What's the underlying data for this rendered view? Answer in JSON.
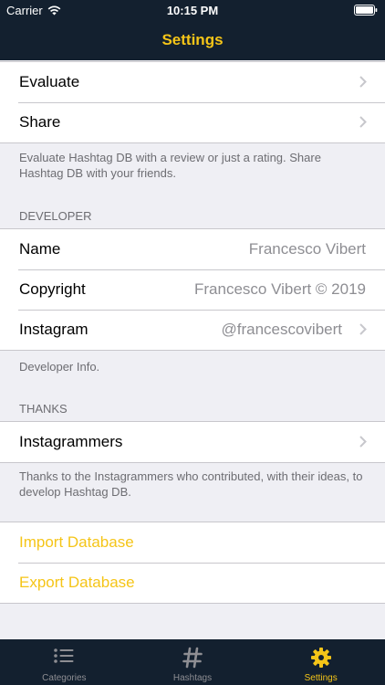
{
  "status_bar": {
    "carrier": "Carrier",
    "time": "10:15 PM"
  },
  "nav": {
    "title": "Settings"
  },
  "section_feedback": {
    "items": [
      {
        "label": "Evaluate"
      },
      {
        "label": "Share"
      }
    ],
    "footer": "Evaluate Hashtag DB with a review or just a rating. Share Hashtag DB with your friends."
  },
  "section_developer": {
    "header": "DEVELOPER",
    "items": [
      {
        "label": "Name",
        "value": "Francesco Vibert"
      },
      {
        "label": "Copyright",
        "value": "Francesco Vibert © 2019"
      },
      {
        "label": "Instagram",
        "value": "@francescovibert"
      }
    ],
    "footer": "Developer Info."
  },
  "section_thanks": {
    "header": "THANKS",
    "items": [
      {
        "label": "Instagrammers"
      }
    ],
    "footer": "Thanks to the Instagrammers who contributed, with their ideas, to develop Hashtag DB."
  },
  "section_database": {
    "items": [
      {
        "label": "Import Database"
      },
      {
        "label": "Export Database"
      }
    ]
  },
  "tab_bar": {
    "tabs": [
      {
        "label": "Categories",
        "icon": "list-icon"
      },
      {
        "label": "Hashtags",
        "icon": "hashtag-icon"
      },
      {
        "label": "Settings",
        "icon": "gear-icon"
      }
    ],
    "active_tab": "Settings"
  },
  "colors": {
    "bar_background": "#13202f",
    "accent": "#f5c518",
    "grouped_background": "#efeff4",
    "secondary_text": "#8e8e93"
  }
}
